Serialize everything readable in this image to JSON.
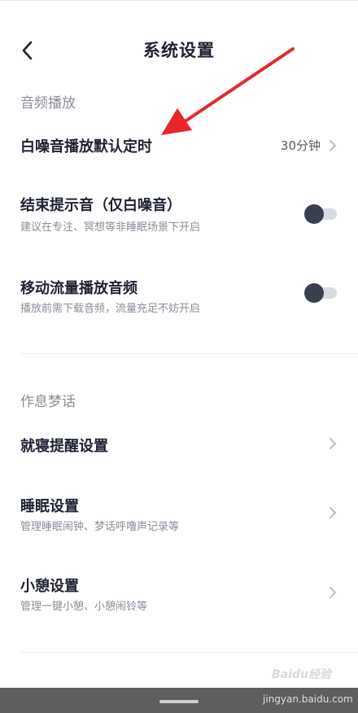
{
  "header": {
    "title": "系统设置"
  },
  "sections": {
    "audio": {
      "title": "音频播放",
      "white_noise_timer": {
        "title": "白噪音播放默认定时",
        "value": "30分钟"
      },
      "end_sound": {
        "title": "结束提示音（仅白噪音）",
        "subtitle": "建议在专注、冥想等非睡眠场景下开启",
        "enabled": false
      },
      "mobile_data": {
        "title": "移动流量播放音频",
        "subtitle": "播放前需下载音频，流量充足不妨开启",
        "enabled": false
      }
    },
    "sleep": {
      "title": "作息梦话",
      "bedtime_reminder": {
        "title": "就寝提醒设置"
      },
      "sleep_settings": {
        "title": "睡眠设置",
        "subtitle": "管理睡眠闹钟、梦话呼噜声记录等"
      },
      "nap_settings": {
        "title": "小憩设置",
        "subtitle": "管理一键小憩、小憩闹铃等"
      }
    }
  },
  "annotation": {
    "arrow_color": "#e8262a"
  },
  "watermark": {
    "logo": "Baidu经验",
    "url": "jingyan.baidu.com"
  },
  "colors": {
    "primary_text": "#1f2233",
    "secondary_text": "#8a8d99",
    "toggle_knob": "#3a3f50",
    "toggle_track": "#d9dbe1"
  }
}
